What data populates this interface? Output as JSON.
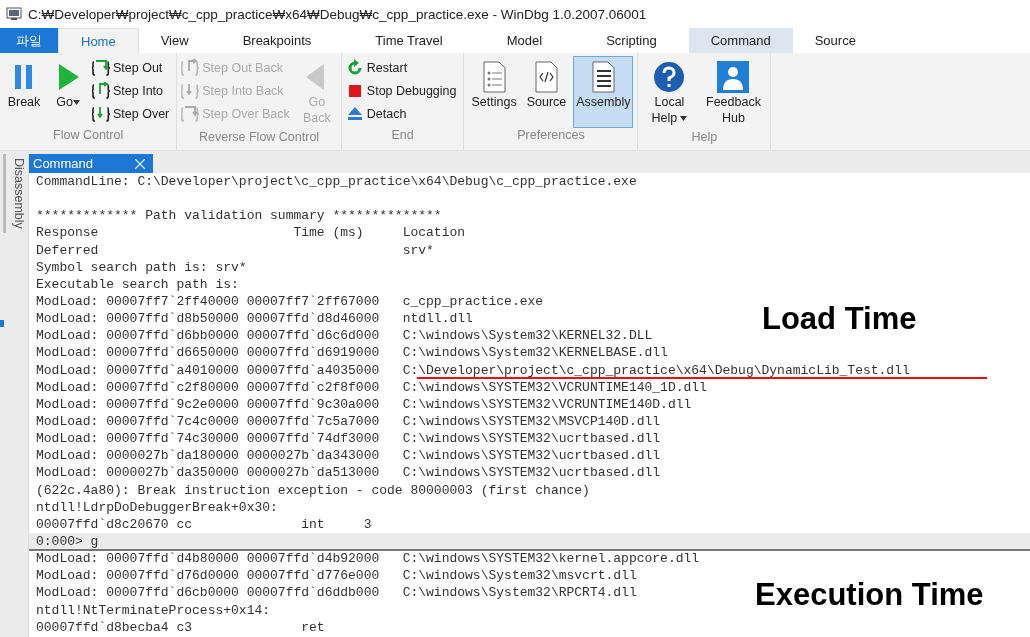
{
  "window": {
    "title": "C:₩Developer₩project₩c_cpp_practice₩x64₩Debug₩c_cpp_practice.exe  - WinDbg 1.0.2007.06001"
  },
  "tabs": [
    {
      "label": "파일",
      "kind": "file",
      "selected": false
    },
    {
      "label": "Home",
      "kind": "normal",
      "selected": true
    },
    {
      "label": "View",
      "kind": "normal",
      "selected": false
    },
    {
      "label": "Breakpoints",
      "kind": "normal",
      "selected": false
    },
    {
      "label": "Time Travel",
      "kind": "normal",
      "selected": false
    },
    {
      "label": "Model",
      "kind": "normal",
      "selected": false
    },
    {
      "label": "Scripting",
      "kind": "normal",
      "selected": false
    },
    {
      "label": "Command",
      "kind": "contextual",
      "selected": false
    },
    {
      "label": "Source",
      "kind": "normal",
      "selected": false
    }
  ],
  "ribbon": {
    "groups": [
      {
        "label": "Flow Control",
        "items": [
          {
            "label": "Break",
            "kind": "large",
            "disabled": false,
            "selected": false,
            "dropdown": false
          },
          {
            "label": "Go",
            "kind": "large",
            "disabled": false,
            "selected": false,
            "dropdown": true
          },
          {
            "label": "Step Out",
            "kind": "small",
            "disabled": false
          },
          {
            "label": "Step Into",
            "kind": "small",
            "disabled": false
          },
          {
            "label": "Step Over",
            "kind": "small",
            "disabled": false
          }
        ]
      },
      {
        "label": "Reverse Flow Control",
        "items": [
          {
            "label": "Step Out Back",
            "kind": "small",
            "disabled": true
          },
          {
            "label": "Step Into Back",
            "kind": "small",
            "disabled": true
          },
          {
            "label": "Step Over Back",
            "kind": "small",
            "disabled": true
          },
          {
            "label": "Go Back",
            "kind": "large",
            "disabled": true,
            "selected": false,
            "dropdown": false
          }
        ]
      },
      {
        "label": "End",
        "items": [
          {
            "label": "Restart",
            "kind": "small",
            "disabled": false
          },
          {
            "label": "Stop Debugging",
            "kind": "small",
            "disabled": false
          },
          {
            "label": "Detach",
            "kind": "small",
            "disabled": false
          }
        ]
      },
      {
        "label": "Preferences",
        "items": [
          {
            "label": "Settings",
            "kind": "large",
            "disabled": false,
            "selected": false,
            "dropdown": false
          },
          {
            "label": "Source",
            "kind": "large",
            "disabled": false,
            "selected": false,
            "dropdown": false
          },
          {
            "label": "Assembly",
            "kind": "large",
            "disabled": false,
            "selected": true,
            "dropdown": false
          }
        ]
      },
      {
        "label": "Help",
        "items": [
          {
            "label": "Local Help",
            "kind": "large",
            "disabled": false,
            "selected": false,
            "dropdown": true
          },
          {
            "label": "Feedback Hub",
            "kind": "large",
            "disabled": false,
            "selected": false,
            "dropdown": false
          }
        ]
      }
    ]
  },
  "side_panel": {
    "label": "Disassembly"
  },
  "document_tab": {
    "label": "Command",
    "selected": true
  },
  "log": [
    {
      "kind": "output",
      "text": "CommandLine: C:\\Developer\\project\\c_cpp_practice\\x64\\Debug\\c_cpp_practice.exe"
    },
    {
      "kind": "blank"
    },
    {
      "kind": "output",
      "text": "************* Path validation summary **************"
    },
    {
      "kind": "output",
      "text": "Response                         Time (ms)     Location"
    },
    {
      "kind": "output",
      "text": "Deferred                                       srv*"
    },
    {
      "kind": "output",
      "text": "Symbol search path is: srv*"
    },
    {
      "kind": "output",
      "text": "Executable search path is: "
    },
    {
      "kind": "output",
      "text": "ModLoad: 00007ff7`2ff40000 00007ff7`2ff67000   c_cpp_practice.exe"
    },
    {
      "kind": "output",
      "text": "ModLoad: 00007ffd`d8b50000 00007ffd`d8d46000   ntdll.dll"
    },
    {
      "kind": "output",
      "text": "ModLoad: 00007ffd`d6bb0000 00007ffd`d6c6d000   C:\\windows\\System32\\KERNEL32.DLL"
    },
    {
      "kind": "output",
      "text": "ModLoad: 00007ffd`d6650000 00007ffd`d6919000   C:\\windows\\System32\\KERNELBASE.dll"
    },
    {
      "kind": "output",
      "text": "ModLoad: 00007ffd`a4010000 00007ffd`a4035000   C:\\Developer\\project\\c_cpp_practice\\x64\\Debug\\DynamicLib_Test.dll",
      "underlined": true
    },
    {
      "kind": "output",
      "text": "ModLoad: 00007ffd`c2f80000 00007ffd`c2f8f000   C:\\windows\\SYSTEM32\\VCRUNTIME140_1D.dll"
    },
    {
      "kind": "output",
      "text": "ModLoad: 00007ffd`9c2e0000 00007ffd`9c30a000   C:\\windows\\SYSTEM32\\VCRUNTIME140D.dll"
    },
    {
      "kind": "output",
      "text": "ModLoad: 00007ffd`7c4c0000 00007ffd`7c5a7000   C:\\windows\\SYSTEM32\\MSVCP140D.dll"
    },
    {
      "kind": "output",
      "text": "ModLoad: 00007ffd`74c30000 00007ffd`74df3000   C:\\windows\\SYSTEM32\\ucrtbased.dll"
    },
    {
      "kind": "output",
      "text": "ModLoad: 0000027b`da180000 0000027b`da343000   C:\\windows\\SYSTEM32\\ucrtbased.dll"
    },
    {
      "kind": "output",
      "text": "ModLoad: 0000027b`da350000 0000027b`da513000   C:\\windows\\SYSTEM32\\ucrtbased.dll"
    },
    {
      "kind": "output",
      "text": "(622c.4a80): Break instruction exception - code 80000003 (first chance)"
    },
    {
      "kind": "output",
      "text": "ntdll!LdrpDoDebuggerBreak+0x30:"
    },
    {
      "kind": "output",
      "text": "00007ffd`d8c20670 cc              int     3"
    },
    {
      "kind": "prompt",
      "text": "0:000> g"
    },
    {
      "kind": "output",
      "text": "ModLoad: 00007ffd`d4b80000 00007ffd`d4b92000   C:\\windows\\SYSTEM32\\kernel.appcore.dll"
    },
    {
      "kind": "output",
      "text": "ModLoad: 00007ffd`d76d0000 00007ffd`d776e000   C:\\windows\\System32\\msvcrt.dll"
    },
    {
      "kind": "output",
      "text": "ModLoad: 00007ffd`d6cb0000 00007ffd`d6ddb000   C:\\windows\\System32\\RPCRT4.dll"
    },
    {
      "kind": "output",
      "text": "ntdll!NtTerminateProcess+0x14:"
    },
    {
      "kind": "output",
      "text": "00007ffd`d8becba4 c3              ret"
    }
  ],
  "annotations": [
    {
      "text": "Load Time",
      "kind": "load"
    },
    {
      "text": "Execution Time",
      "kind": "execution"
    }
  ]
}
